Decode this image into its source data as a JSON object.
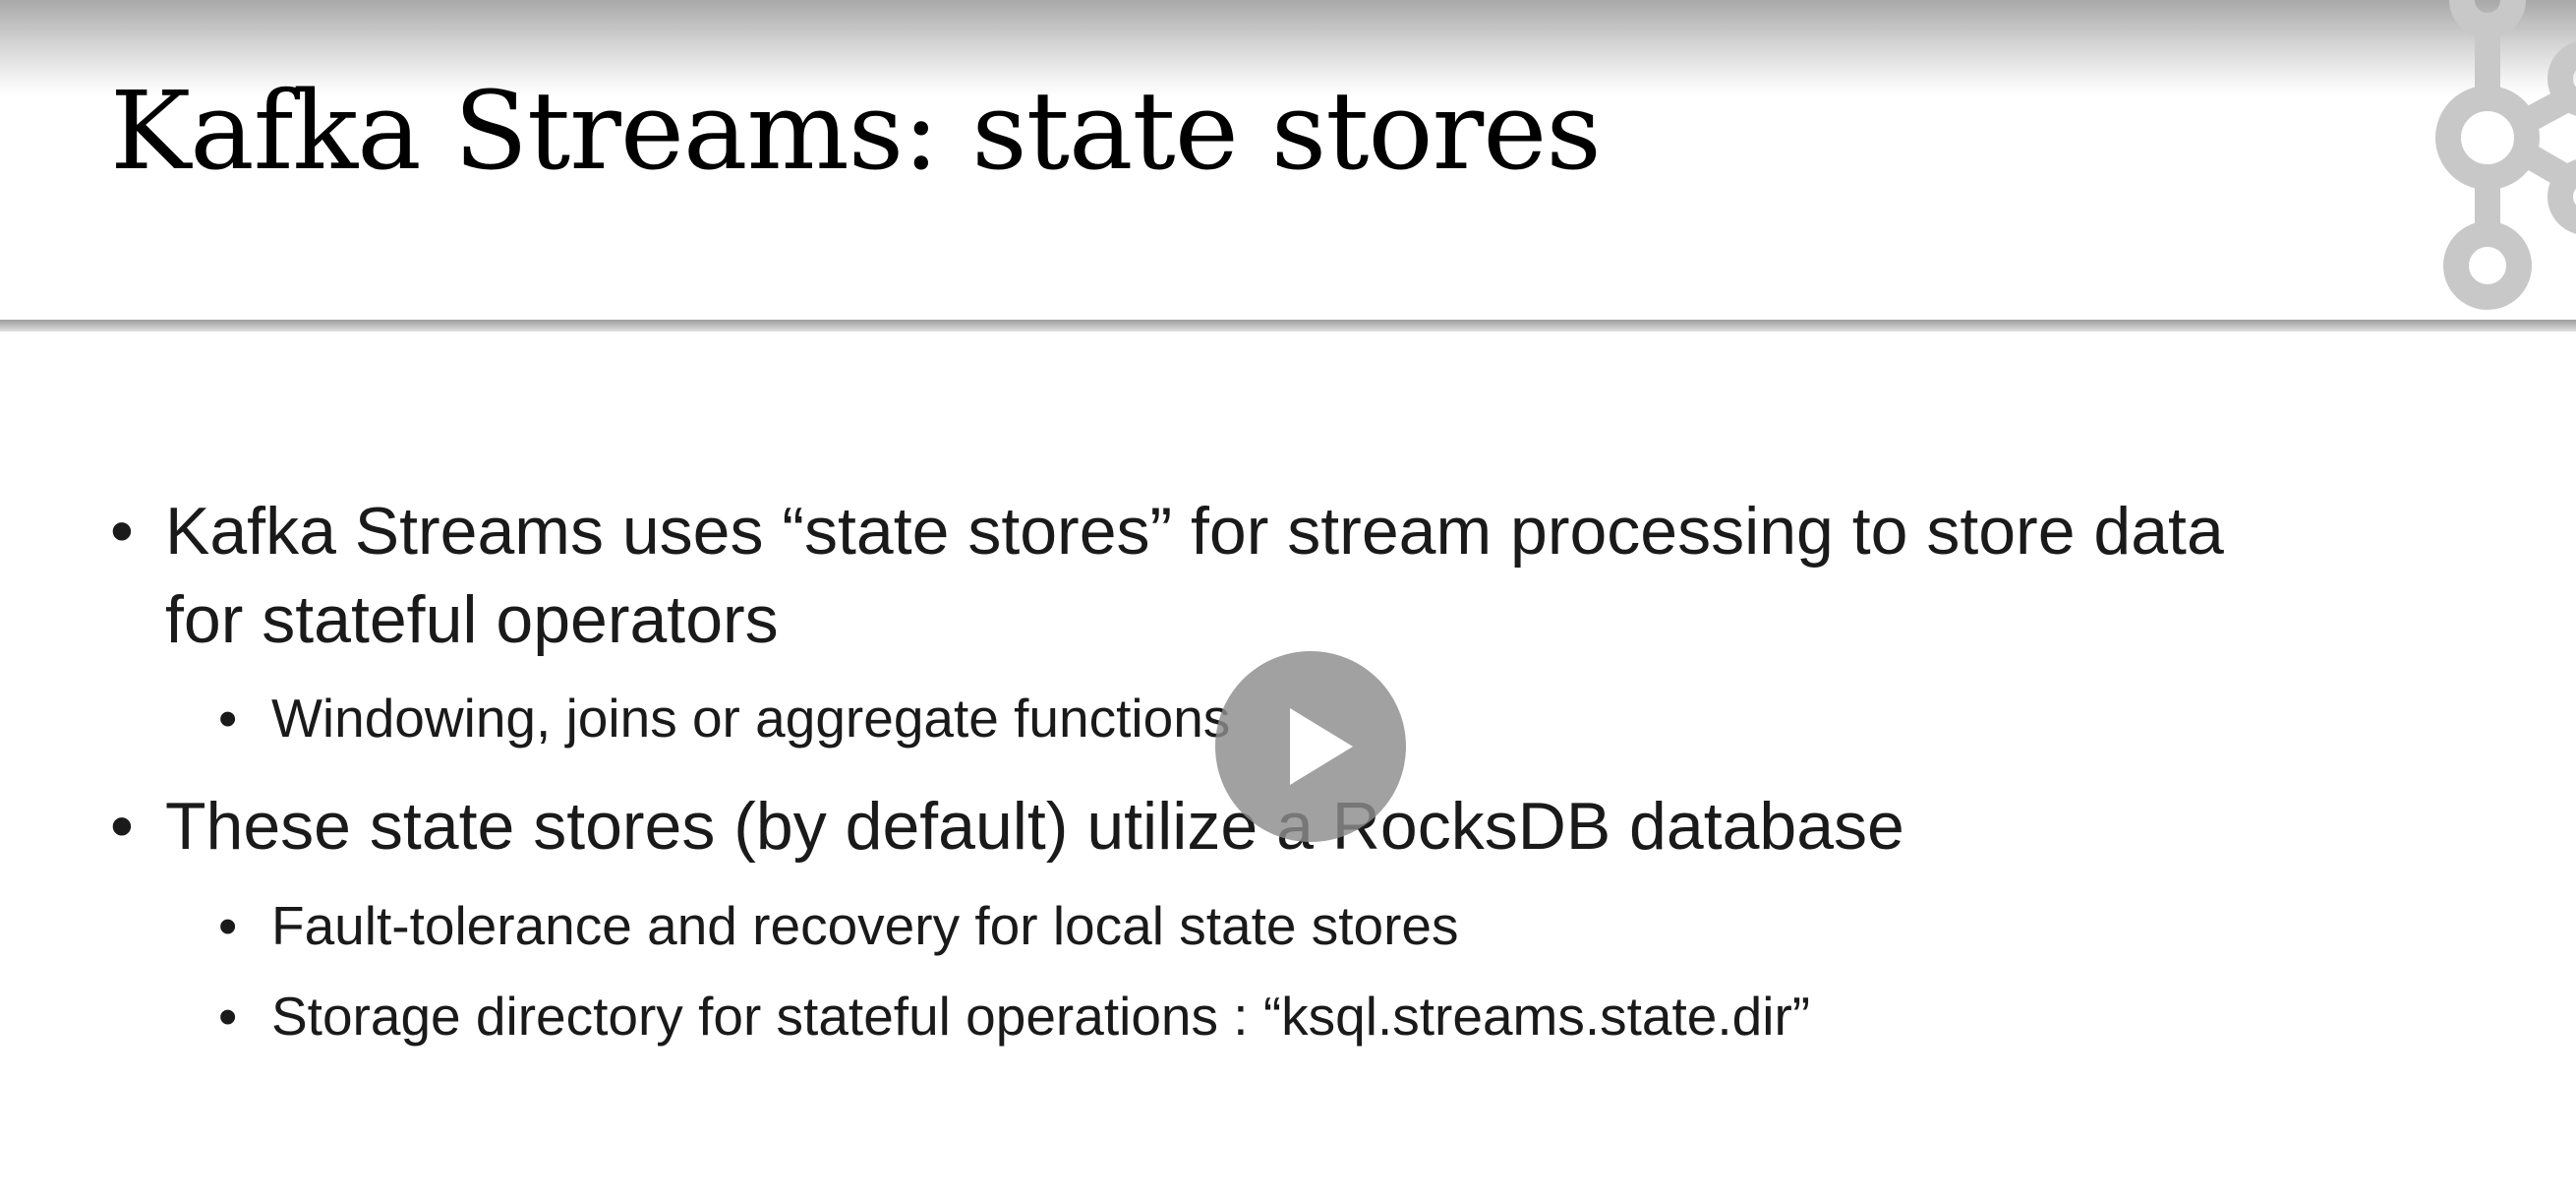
{
  "slide": {
    "title": "Kafka Streams: state stores",
    "bullets": [
      {
        "line1": "Kafka Streams uses “state stores” for stream processing to store data",
        "line2": "for stateful operators",
        "sub": [
          "Windowing, joins or aggregate functions"
        ]
      },
      {
        "line1": "These state stores (by default) utilize a RocksDB database",
        "sub": [
          "Fault-tolerance and recovery for local state stores",
          "Storage directory for stateful operations : “ksql.streams.state.dir”"
        ]
      }
    ],
    "bullet_glyph": "•"
  },
  "player": {
    "play_icon": "play-icon"
  },
  "colors": {
    "background": "#ffffff",
    "text": "#1a1a1a",
    "logo": "#c8c8c8",
    "play_button": "#8c8c8c"
  }
}
